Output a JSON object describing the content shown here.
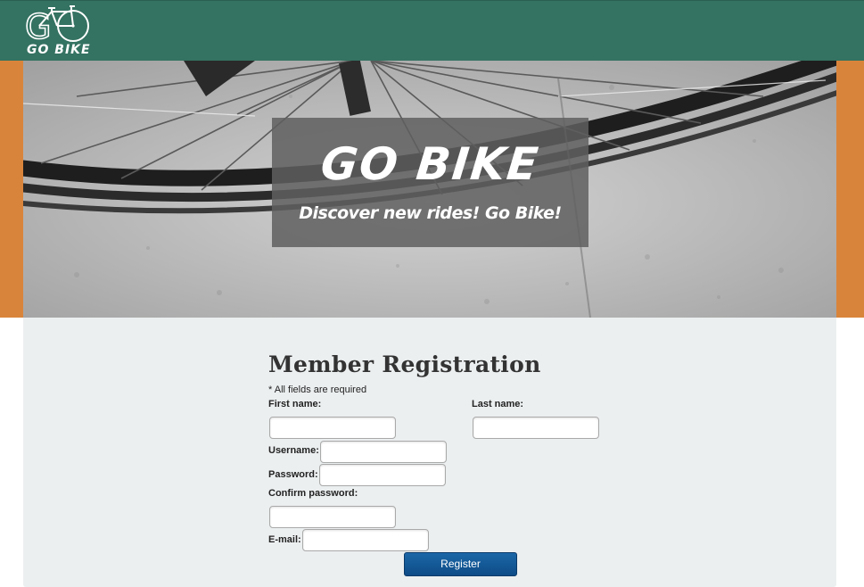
{
  "header": {
    "logo_text": "GO BIKE",
    "logo_icon": "bicycle-icon",
    "background_color": "#347261"
  },
  "hero": {
    "title": "GO BIKE",
    "subtitle": "Discover new rides! Go Bike!",
    "side_color": "#d9843b"
  },
  "form": {
    "title": "Member Registration",
    "required_note": "* All fields are required",
    "first_name_label": "First name:",
    "last_name_label": "Last name:",
    "username_label": "Username:",
    "password_label": "Password:",
    "confirm_password_label": "Confirm password:",
    "email_label": "E-mail:",
    "first_name_value": "",
    "last_name_value": "",
    "username_value": "",
    "password_value": "",
    "confirm_password_value": "",
    "email_value": "",
    "register_label": "Register",
    "button_color": "#1a5f9e"
  }
}
